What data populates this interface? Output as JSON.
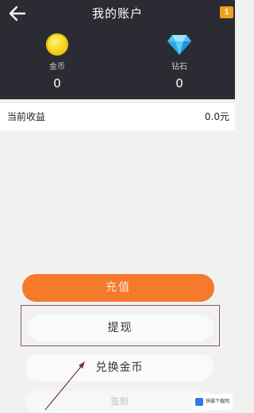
{
  "header": {
    "title": "我的账户",
    "notice_badge": "1"
  },
  "balances": {
    "gold": {
      "label": "金币",
      "value": "0"
    },
    "diamond": {
      "label": "钻石",
      "value": "0"
    }
  },
  "earnings": {
    "label": "当前收益",
    "value": "0.0元"
  },
  "actions": {
    "recharge_label": "充值",
    "withdraw_label": "提现",
    "exchange_label": "兑换金币",
    "faded_label": "签到"
  },
  "watermark": {
    "text": "快猫下载网"
  },
  "colors": {
    "header_bg": "#2b2c33",
    "accent_orange": "#f57a2c",
    "gold": "#f8d824",
    "diamond": "#4fc3f7"
  }
}
